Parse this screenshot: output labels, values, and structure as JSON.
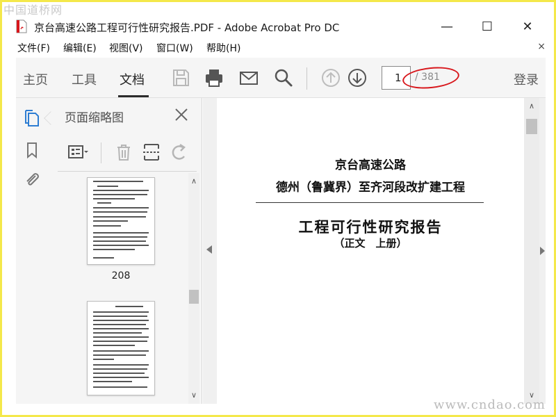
{
  "watermark": {
    "top": "中国道桥网",
    "bottom": "www.cndao.com"
  },
  "window": {
    "title": "京台高速公路工程可行性研究报告.PDF - Adobe Acrobat Pro DC",
    "minimize": "—",
    "maximize": "☐",
    "close": "✕"
  },
  "menu": {
    "items": [
      "文件(F)",
      "编辑(E)",
      "视图(V)",
      "窗口(W)",
      "帮助(H)"
    ],
    "close": "×"
  },
  "toolbar": {
    "tabs": [
      "主页",
      "工具",
      "文档"
    ],
    "active_tab": "文档",
    "page_current": "1",
    "page_total": "/ 381",
    "login": "登录"
  },
  "panel": {
    "title": "页面缩略图",
    "thumbnails": [
      {
        "label": "208"
      },
      {
        "label": ""
      }
    ]
  },
  "document": {
    "line1": "京台高速公路",
    "line2": "德州（鲁冀界）至齐河段改扩建工程",
    "line3": "工程可行性研究报告",
    "line4": "（正文　上册）"
  },
  "colors": {
    "accent": "#2d7dd2",
    "highlight": "#d8171c"
  }
}
